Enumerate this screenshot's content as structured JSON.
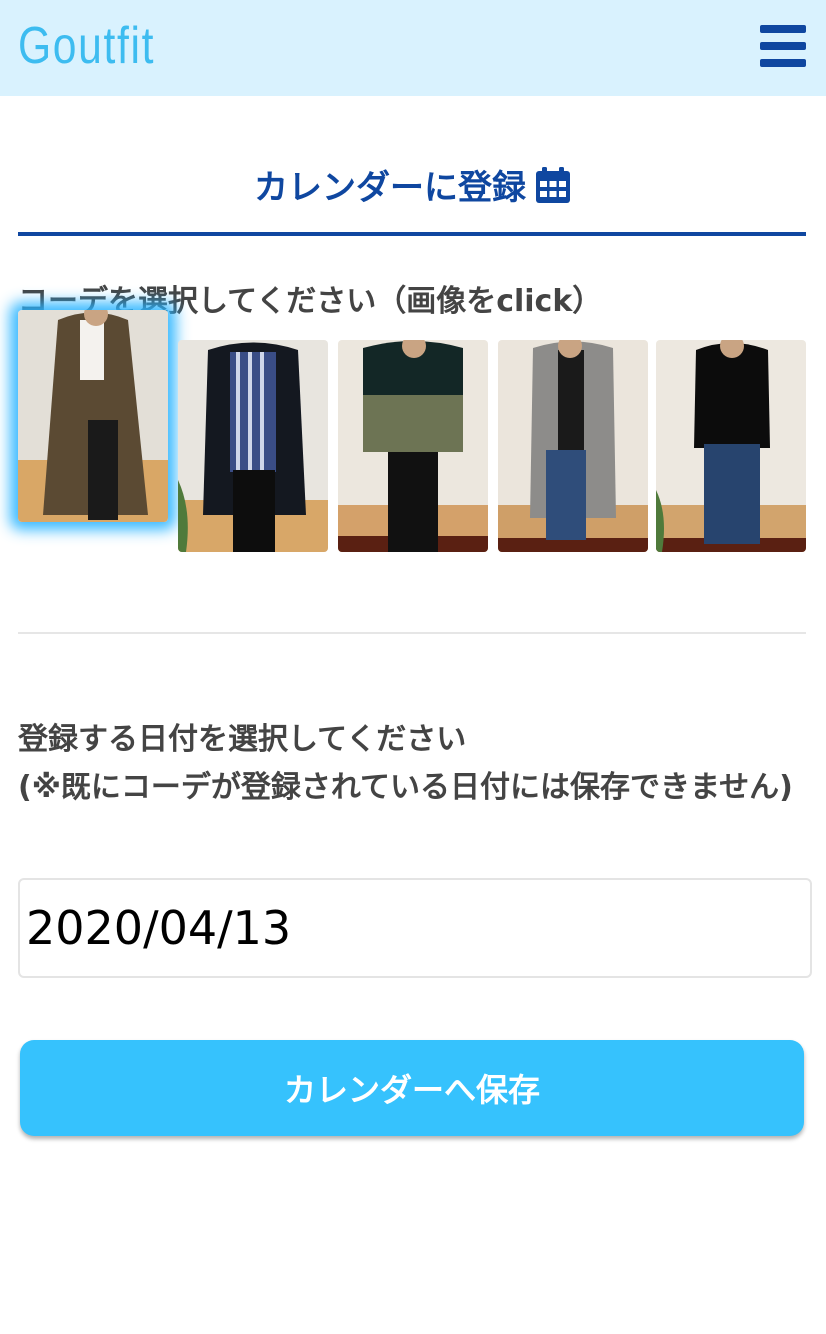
{
  "header": {
    "logo": "Goutfit",
    "menu_icon": "hamburger-menu-icon",
    "background": "#d9f2fe",
    "accent": "#0f47a0"
  },
  "page": {
    "title": "カレンダーに登録",
    "title_icon": "calendar-icon"
  },
  "outfit_select": {
    "label": "コーデを選択してください（画像をclick）",
    "selected_index": 0,
    "items": [
      {
        "name": "outfit-brown-coat"
      },
      {
        "name": "outfit-black-coat-striped-shirt"
      },
      {
        "name": "outfit-khaki-parka"
      },
      {
        "name": "outfit-gray-coat-jeans"
      },
      {
        "name": "outfit-black-sweater-jeans"
      }
    ]
  },
  "date_select": {
    "label_line1": "登録する日付を選択してください",
    "label_line2": "(※既にコーデが登録されている日付には保存できません)",
    "value": "2020/04/13"
  },
  "save_button": {
    "label": "カレンダーへ保存",
    "color": "#36c2fd"
  }
}
